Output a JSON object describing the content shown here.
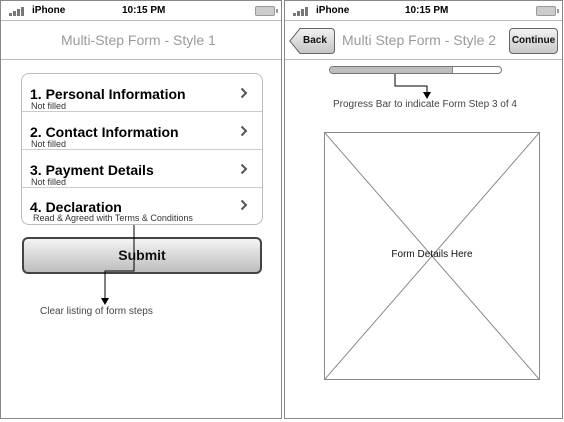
{
  "left_screen": {
    "status": {
      "carrier": "iPhone",
      "time": "10:15 PM"
    },
    "title": "Multi-Step Form - Style 1",
    "steps": [
      {
        "title": "1. Personal Information",
        "status": "Not filled"
      },
      {
        "title": "2. Contact Information",
        "status": "Not filled"
      },
      {
        "title": "3. Payment Details",
        "status": "Not filled"
      },
      {
        "title": "4. Declaration",
        "status": "Read & Agreed with Terms & Conditions"
      }
    ],
    "submit_label": "Submit",
    "annotation": "Clear listing of form steps"
  },
  "right_screen": {
    "status": {
      "carrier": "iPhone",
      "time": "10:15 PM"
    },
    "title": "Multi Step Form - Style 2",
    "back_label": "Back",
    "continue_label": "Continue",
    "progress": {
      "current_step": 3,
      "total_steps": 4,
      "fill_fraction": 0.72
    },
    "progress_annotation": "Progress Bar to indicate Form Step 3 of 4",
    "placeholder_label": "Form Details Here"
  },
  "colors": {
    "border": "#888888",
    "title_gray": "#9a9a9a",
    "progress_fill": "#bdbdbd"
  },
  "icons": [
    "signal-icon",
    "battery-icon",
    "chevron-right-icon",
    "back-arrow-icon",
    "image-placeholder-icon",
    "annotation-arrow-icon"
  ]
}
